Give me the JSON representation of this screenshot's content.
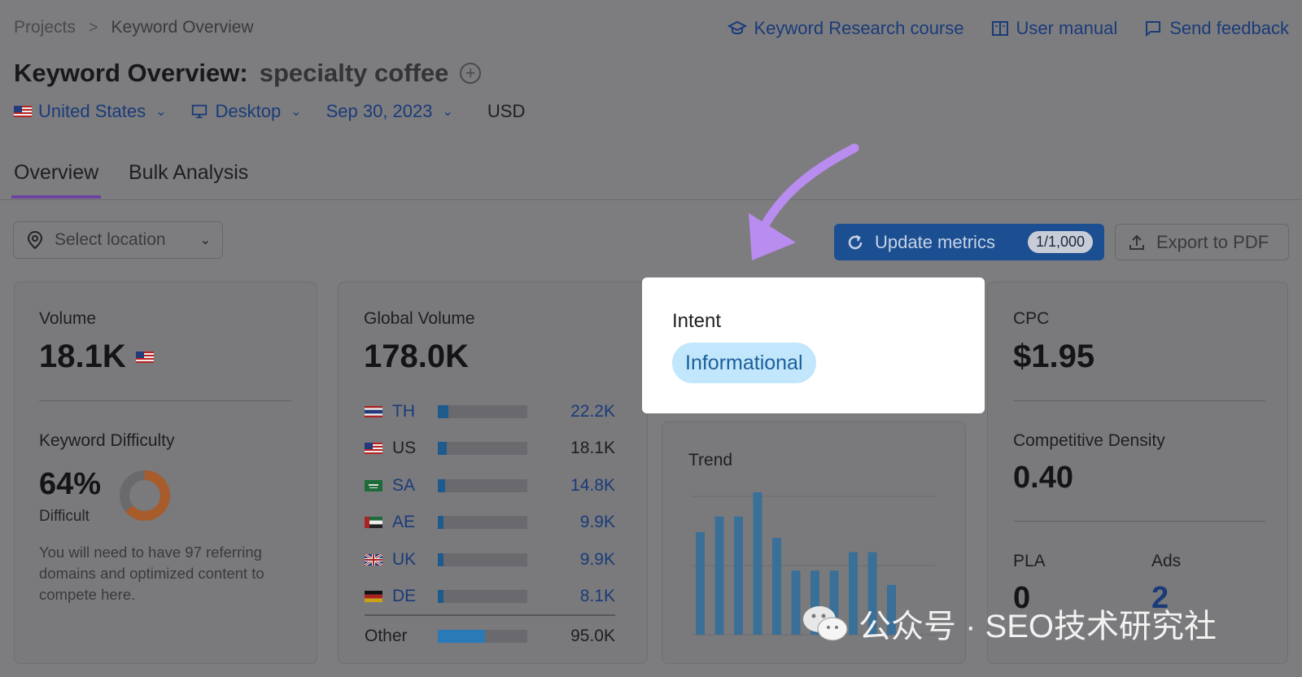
{
  "breadcrumb": {
    "parent": "Projects",
    "separator": ">",
    "current": "Keyword Overview"
  },
  "toplinks": {
    "course": "Keyword Research course",
    "manual": "User manual",
    "feedback": "Send feedback"
  },
  "title": {
    "prefix": "Keyword Overview:",
    "keyword": "specialty coffee",
    "add_symbol": "+"
  },
  "filters": {
    "country": "United States",
    "device": "Desktop",
    "date": "Sep 30, 2023",
    "currency": "USD"
  },
  "tabs": [
    {
      "label": "Overview",
      "active": true
    },
    {
      "label": "Bulk Analysis",
      "active": false
    }
  ],
  "location_select": {
    "placeholder": "Select location"
  },
  "actions": {
    "update_label": "Update metrics",
    "update_count": "1/1,000",
    "export_label": "Export to PDF"
  },
  "volume": {
    "label": "Volume",
    "value": "18.1K",
    "kd_label": "Keyword Difficulty",
    "kd_value": "64%",
    "kd_rating": "Difficult",
    "kd_percent": 64,
    "kd_note": "You will need to have 97 referring domains and optimized content to compete here."
  },
  "global_volume": {
    "label": "Global Volume",
    "value": "178.0K",
    "countries": [
      {
        "code": "TH",
        "value": "22.2K",
        "share": 0.12,
        "link": true
      },
      {
        "code": "US",
        "value": "18.1K",
        "share": 0.1,
        "link": false
      },
      {
        "code": "SA",
        "value": "14.8K",
        "share": 0.08,
        "link": true
      },
      {
        "code": "AE",
        "value": "9.9K",
        "share": 0.055,
        "link": true
      },
      {
        "code": "UK",
        "value": "9.9K",
        "share": 0.055,
        "link": true
      },
      {
        "code": "DE",
        "value": "8.1K",
        "share": 0.045,
        "link": true
      }
    ],
    "other": {
      "label": "Other",
      "value": "95.0K",
      "share": 0.53
    }
  },
  "intent": {
    "label": "Intent",
    "value": "Informational"
  },
  "trend": {
    "label": "Trend",
    "values": [
      0.72,
      0.83,
      0.83,
      1.0,
      0.68,
      0.45,
      0.45,
      0.45,
      0.58,
      0.58,
      0.35
    ]
  },
  "cpc": {
    "label": "CPC",
    "value": "$1.95",
    "cd_label": "Competitive Density",
    "cd_value": "0.40",
    "pla_label": "PLA",
    "pla_value": "0",
    "ads_label": "Ads",
    "ads_value": "2"
  },
  "watermark": {
    "text": "公众号 · SEO技术研究社"
  },
  "colors": {
    "accent_purple": "#b98cf0",
    "brand_blue": "#1c4f91",
    "intent_badge": "#c2e6fb"
  }
}
